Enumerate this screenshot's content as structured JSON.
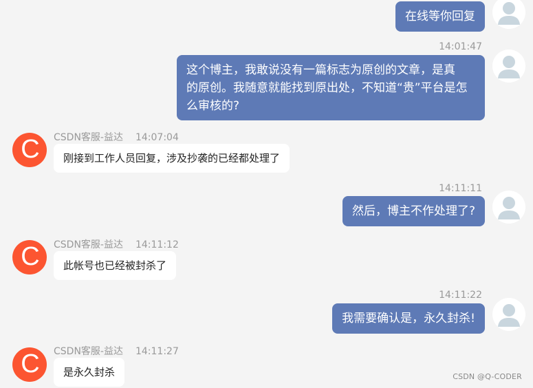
{
  "colors": {
    "background": "#f4f4f4",
    "outgoing_bubble": "#5e7ab6",
    "incoming_bubble": "#ffffff",
    "cs_avatar": "#fc5531",
    "timestamp": "#999999"
  },
  "cs_avatar_letter": "C",
  "messages": [
    {
      "direction": "outgoing",
      "time": "",
      "text": "在线等你回复"
    },
    {
      "direction": "outgoing",
      "time": "14:01:47",
      "lines": [
        "这个博主，我敢说没有一篇标志为原创的文章，是真",
        "的原创。我随意就能找到原出处，不知道“贵”平台是怎",
        "么审核的?"
      ]
    },
    {
      "direction": "incoming",
      "sender": "CSDN客服-益达",
      "time": "14:07:04",
      "text": "刚接到工作人员回复，涉及抄袭的已经都处理了"
    },
    {
      "direction": "outgoing",
      "time": "14:11:11",
      "text": "然后，博主不作处理了?"
    },
    {
      "direction": "incoming",
      "sender": "CSDN客服-益达",
      "time": "14:11:12",
      "text": "此帐号也已经被封杀了"
    },
    {
      "direction": "outgoing",
      "time": "14:11:22",
      "text": "我需要确认是，永久封杀!"
    },
    {
      "direction": "incoming",
      "sender": "CSDN客服-益达",
      "time": "14:11:27",
      "text": "是永久封杀"
    }
  ],
  "watermark": "CSDN @Q-CODER"
}
